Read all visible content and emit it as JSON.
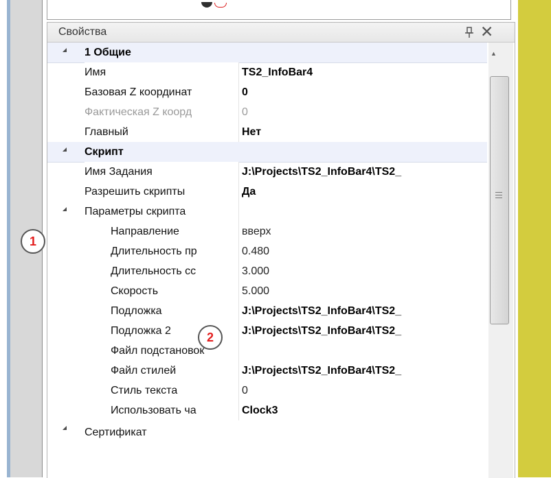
{
  "panel": {
    "title": "Свойства"
  },
  "categories": [
    {
      "title": "1 Общие",
      "rows": [
        {
          "name": "Имя",
          "value": "TS2_InfoBar4",
          "bold": true
        },
        {
          "name": "Базовая Z координат",
          "value": "0",
          "bold": true
        },
        {
          "name": "Фактическая Z коорд",
          "value": "0",
          "gray": true
        },
        {
          "name": "Главный",
          "value": "Нет",
          "bold": true
        }
      ]
    },
    {
      "title": "Скрипт",
      "rows": [
        {
          "name": "Имя Задания",
          "value": "J:\\Projects\\TS2_InfoBar4\\TS2_",
          "bold": true
        },
        {
          "name": "Разрешить скрипты",
          "value": "Да",
          "bold": true
        },
        {
          "name": "Параметры скрипта",
          "value": ""
        }
      ],
      "subrows": [
        {
          "name": "Направление",
          "value": "вверх"
        },
        {
          "name": "Длительность пр",
          "value": "0.480"
        },
        {
          "name": "Длительность сс",
          "value": "3.000"
        },
        {
          "name": "Скорость",
          "value": "5.000"
        },
        {
          "name": "Подложка",
          "value": "J:\\Projects\\TS2_InfoBar4\\TS2_",
          "bold": true
        },
        {
          "name": "Подложка 2",
          "value": "J:\\Projects\\TS2_InfoBar4\\TS2_",
          "bold": true
        },
        {
          "name": "Файл подстановок",
          "value": ""
        },
        {
          "name": "Файл стилей",
          "value": "J:\\Projects\\TS2_InfoBar4\\TS2_",
          "bold": true
        },
        {
          "name": "Стиль текста",
          "value": "0"
        },
        {
          "name": "Использовать ча",
          "value": "Clock3",
          "bold": true
        }
      ]
    },
    {
      "title": "Сертификат"
    }
  ],
  "callouts": [
    "1",
    "2"
  ],
  "icons": {
    "pin": "pin-icon",
    "close": "close-icon",
    "expand": "collapse-triangle-icon",
    "scroll_up": "scroll-up-arrow-icon",
    "grip": "scroll-grip-icon"
  },
  "colors": {
    "accent_left": "#99b4d1",
    "right_panel": "#d3cc3e",
    "callout_text": "#e31d1d"
  }
}
